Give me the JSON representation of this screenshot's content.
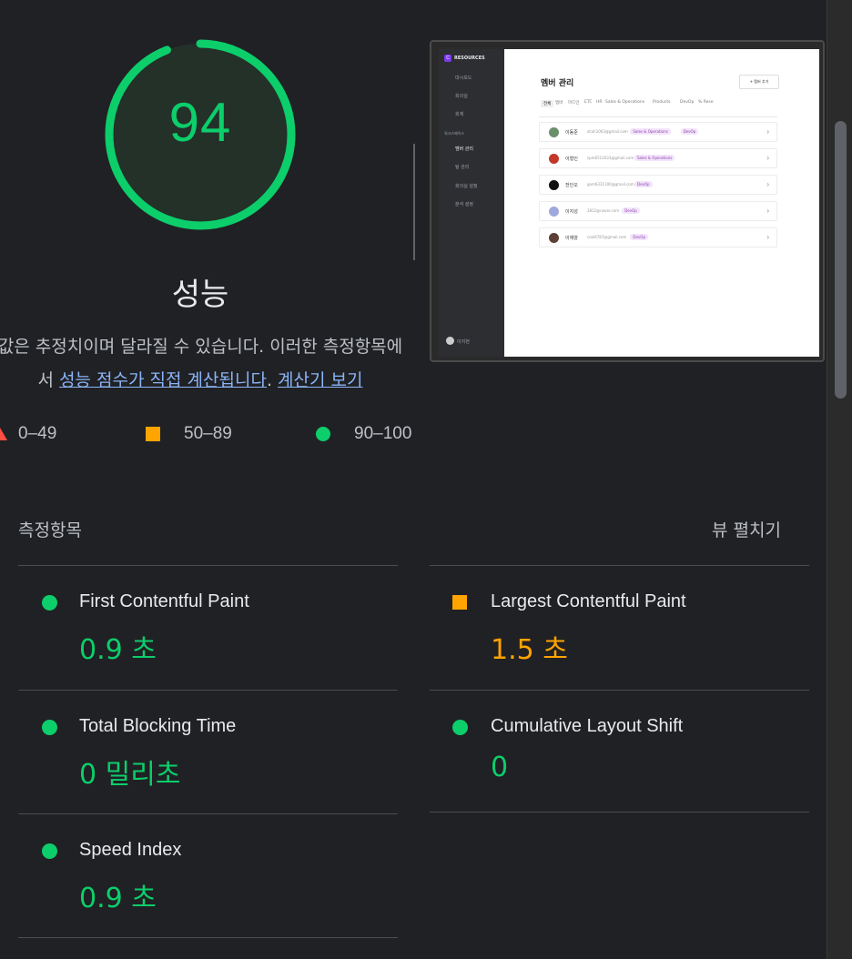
{
  "performance": {
    "score": "94",
    "score_fraction": 0.94,
    "title": "성능",
    "desc_prefix": "값은 추정치이며 달라질 수 있습니다. 이러한 측정항목에",
    "desc_line2_prefix": "서 ",
    "desc_link1": "성능 점수가 직접 계산됩니다",
    "desc_mid": ". ",
    "desc_link2": "계산기 보기",
    "colors": {
      "pass": "#0cce6b",
      "average": "#ffa400",
      "fail": "#ff4e42"
    }
  },
  "legend": [
    {
      "icon": "triangle-fail-icon",
      "label": "0–49"
    },
    {
      "icon": "square-average-icon",
      "label": "50–89"
    },
    {
      "icon": "circle-pass-icon",
      "label": "90–100"
    }
  ],
  "screenshot": {
    "brand": "RESOURCES",
    "brand_badge": "C",
    "sidebar_items": [
      "대시보드",
      "회의실",
      "회계"
    ],
    "sidebar_section": "워크스페이스",
    "sidebar_items2": [
      "멤버 관리",
      "팀 관리",
      "회의실 설정",
      "분석 설정"
    ],
    "user": "이지현",
    "page_title": "멤버 관리",
    "add_button": "+ 멤버 추가",
    "tabs": [
      "전체",
      "멤버",
      "마드민",
      "ETC",
      "HR",
      "Sales & Operations",
      "Products",
      "DevOp",
      "% Rese"
    ],
    "members": [
      {
        "name": "이동준",
        "email": "dcoh1063@gmail.com",
        "tags": [
          "Sales & Operations",
          "DevOp"
        ],
        "avatar": "#6b8e6b"
      },
      {
        "name": "이형인",
        "email": "spm6511633@gmail.com",
        "tags": [
          "Sales & Operations"
        ],
        "avatar": "#c0392b"
      },
      {
        "name": "전인오",
        "email": "gom6331100@gmail.com",
        "tags": [
          "DevOp"
        ],
        "avatar": "#111111"
      },
      {
        "name": "이지성",
        "email": "2812@naver.com",
        "tags": [
          "DevOp"
        ],
        "avatar": "#9fa8da"
      },
      {
        "name": "이재양",
        "email": "cool6787@gmail.com",
        "tags": [
          "DevOp"
        ],
        "avatar": "#5d4037"
      }
    ]
  },
  "metrics": {
    "header": "측정항목",
    "expand_label": "뷰 펼치기",
    "items": [
      {
        "title": "First Contentful Paint",
        "value": "0.9 초",
        "status": "pass",
        "icon": "circle-pass-icon"
      },
      {
        "title": "Largest Contentful Paint",
        "value": "1.5 초",
        "status": "average",
        "icon": "square-average-icon"
      },
      {
        "title": "Total Blocking Time",
        "value": "0 밀리초",
        "status": "pass",
        "icon": "circle-pass-icon"
      },
      {
        "title": "Cumulative Layout Shift",
        "value": "0",
        "status": "pass",
        "icon": "circle-pass-icon"
      },
      {
        "title": "Speed Index",
        "value": "0.9 초",
        "status": "pass",
        "icon": "circle-pass-icon"
      }
    ]
  }
}
